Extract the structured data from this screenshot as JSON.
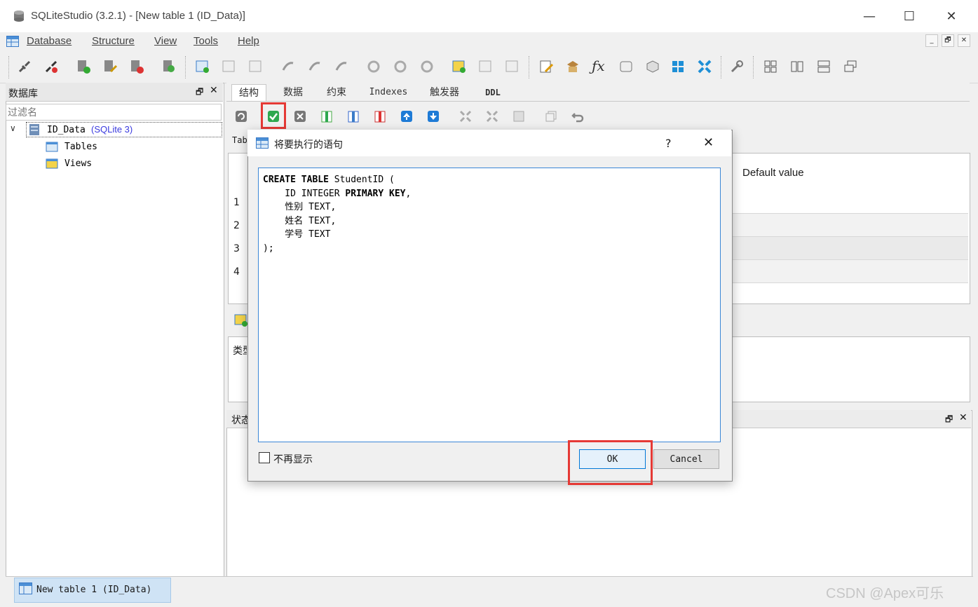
{
  "window": {
    "title": "SQLiteStudio (3.2.1) - [New table 1 (ID_Data)]",
    "minimize": "—",
    "maximize": "☐",
    "close": "✕"
  },
  "menubar": {
    "items": [
      "Database",
      "Structure",
      "View",
      "Tools",
      "Help"
    ],
    "mdi_controls": [
      "_",
      "🗗",
      "✕"
    ]
  },
  "db_panel": {
    "title": "数据库",
    "float_icon": "🗗",
    "close_icon": "✕",
    "filter_placeholder": "过滤名",
    "tree": {
      "db_name": "ID_Data",
      "db_type": "(SQLite 3)",
      "children": [
        "Tables",
        "Views"
      ]
    }
  },
  "editor": {
    "tabs": [
      "结构",
      "数据",
      "约束",
      "Indexes",
      "触发器",
      "DDL"
    ],
    "table_label_clip": "Tab",
    "grid_header_default": "Default value",
    "row_numbers": [
      "1",
      "2",
      "3",
      "4"
    ],
    "lower_label_clip": "类型",
    "status_label_clip": "状态"
  },
  "dialog": {
    "title": "将要执行的语句",
    "help": "?",
    "close": "✕",
    "sql_lines": [
      [
        {
          "t": "CREATE TABLE",
          "b": true
        },
        {
          "t": " StudentID (",
          "b": false
        }
      ],
      [
        {
          "t": "    ID INTEGER ",
          "b": false
        },
        {
          "t": "PRIMARY KEY",
          "b": true
        },
        {
          "t": ",",
          "b": false
        }
      ],
      [
        {
          "t": "    性别 TEXT,",
          "b": false
        }
      ],
      [
        {
          "t": "    姓名 TEXT,",
          "b": false
        }
      ],
      [
        {
          "t": "    学号 TEXT",
          "b": false
        }
      ],
      [
        {
          "t": ");",
          "b": false
        }
      ]
    ],
    "checkbox_label": "不再显示",
    "ok_label": "OK",
    "cancel_label": "Cancel"
  },
  "taskbar": {
    "tab_label": "New table 1 (ID_Data)"
  },
  "watermark": "CSDN @Apex可乐",
  "colors": {
    "highlight": "#e53935",
    "accent": "#0078d7",
    "db_type": "#3a3adf"
  }
}
